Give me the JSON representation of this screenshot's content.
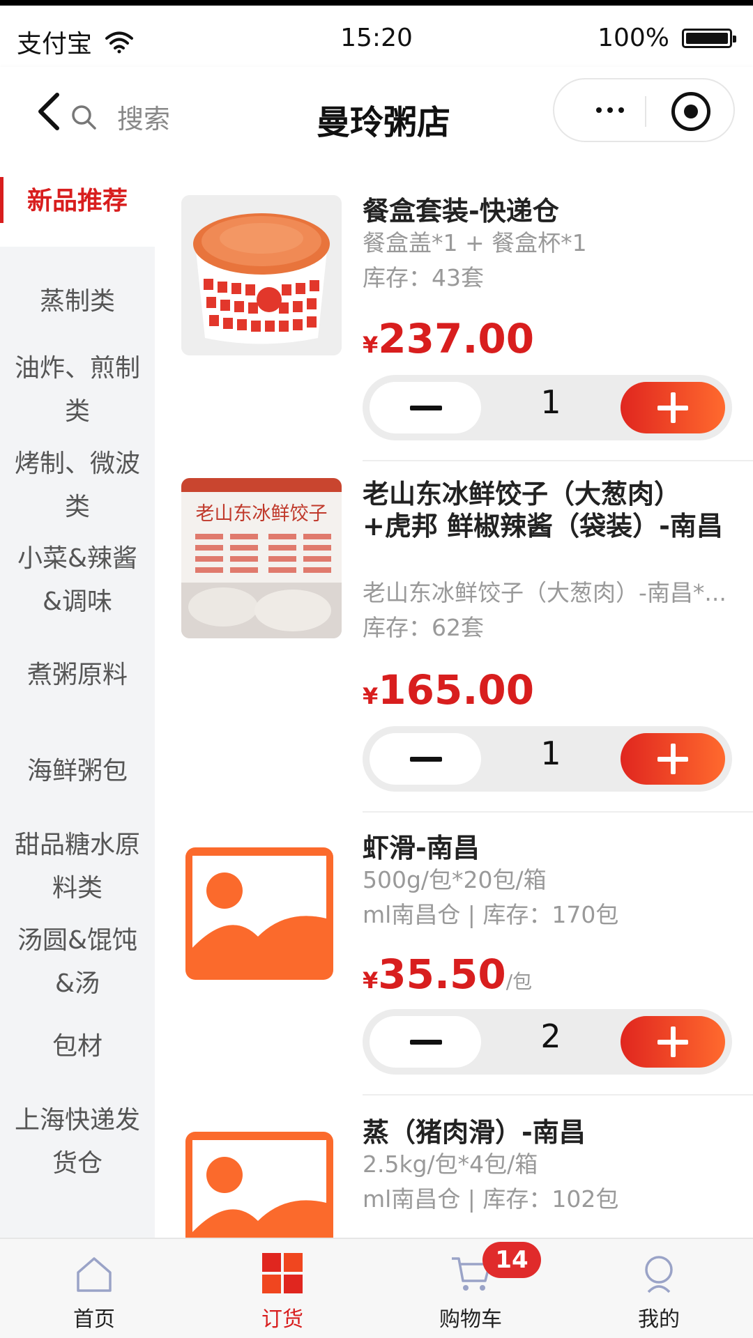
{
  "status_bar": {
    "carrier": "支付宝",
    "time": "15:20",
    "battery": "100%"
  },
  "nav": {
    "search_label": "搜索",
    "title": "曼玲粥店"
  },
  "sidebar": {
    "items": [
      {
        "label": "新品推荐",
        "active": true
      },
      {
        "label": "蒸制类"
      },
      {
        "label": "油炸、煎制类"
      },
      {
        "label": "烤制、微波类"
      },
      {
        "label": "小菜&辣酱&调味"
      },
      {
        "label": "煮粥原料"
      },
      {
        "label": "海鲜粥包"
      },
      {
        "label": "甜品糖水原料类"
      },
      {
        "label": "汤圆&馄饨&汤"
      },
      {
        "label": "包材"
      },
      {
        "label": "上海快递发货仓"
      }
    ]
  },
  "products": [
    {
      "name": "餐盒套装-快递仓",
      "subtitle": "餐盒盖*1 + 餐盒杯*1",
      "stock": "库存：43套",
      "currency": "¥",
      "price": "237.00",
      "unit": "",
      "qty": "1",
      "image": "bowl-photo"
    },
    {
      "name": "老山东冰鲜饺子（大葱肉）+虎邦 鲜椒辣酱（袋装）-南昌",
      "subtitle": "老山东冰鲜饺子（大葱肉）-南昌*...",
      "stock": "库存：62套",
      "currency": "¥",
      "price": "165.00",
      "unit": "",
      "qty": "1",
      "image": "dumpling-bag-photo",
      "image_text": "老山东冰鲜饺子"
    },
    {
      "name": "虾滑-南昌",
      "subtitle": "500g/包*20包/箱",
      "stock": "ml南昌仓 | 库存：170包",
      "currency": "¥",
      "price": "35.50",
      "unit": "/包",
      "qty": "2",
      "image": "placeholder-image-icon"
    },
    {
      "name": "蒸（猪肉滑）-南昌",
      "subtitle": "2.5kg/包*4包/箱",
      "stock": "ml南昌仓 | 库存：102包",
      "image": "placeholder-image-icon"
    }
  ],
  "tabbar": {
    "items": [
      {
        "label": "首页",
        "icon": "home-icon"
      },
      {
        "label": "订货",
        "icon": "grid-icon",
        "active": true
      },
      {
        "label": "购物车",
        "icon": "cart-icon"
      },
      {
        "label": "我的",
        "icon": "user-icon"
      }
    ],
    "cart_badge": "14"
  },
  "colors": {
    "accent": "#d81e1e",
    "orange": "#ff6a2e",
    "placeholder": "#fb6a2c"
  }
}
